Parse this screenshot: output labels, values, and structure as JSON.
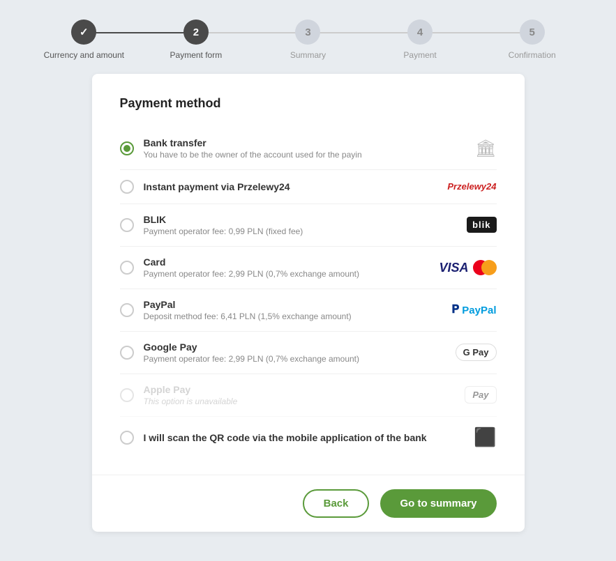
{
  "stepper": {
    "steps": [
      {
        "number": "✓",
        "label": "Currency and amount",
        "state": "completed"
      },
      {
        "number": "2",
        "label": "Payment form",
        "state": "active"
      },
      {
        "number": "3",
        "label": "Summary",
        "state": "inactive"
      },
      {
        "number": "4",
        "label": "Payment",
        "state": "inactive"
      },
      {
        "number": "5",
        "label": "Confirmation",
        "state": "inactive"
      }
    ]
  },
  "card": {
    "title": "Payment method",
    "options": [
      {
        "id": "bank-transfer",
        "selected": true,
        "disabled": false,
        "title": "Bank transfer",
        "subtitle": "You have to be the owner of the account used for the payin",
        "logo_type": "bank"
      },
      {
        "id": "przelewy24",
        "selected": false,
        "disabled": false,
        "title": "Instant payment via Przelewy24",
        "subtitle": "",
        "logo_type": "p24"
      },
      {
        "id": "blik",
        "selected": false,
        "disabled": false,
        "title": "BLIK",
        "subtitle": "Payment operator fee: 0,99 PLN (fixed fee)",
        "logo_type": "blik"
      },
      {
        "id": "card",
        "selected": false,
        "disabled": false,
        "title": "Card",
        "subtitle": "Payment operator fee: 2,99 PLN (0,7% exchange amount)",
        "logo_type": "card"
      },
      {
        "id": "paypal",
        "selected": false,
        "disabled": false,
        "title": "PayPal",
        "subtitle": "Deposit method fee: 6,41 PLN (1,5% exchange amount)",
        "logo_type": "paypal"
      },
      {
        "id": "google-pay",
        "selected": false,
        "disabled": false,
        "title": "Google Pay",
        "subtitle": "Payment operator fee: 2,99 PLN (0,7% exchange amount)",
        "logo_type": "gpay"
      },
      {
        "id": "apple-pay",
        "selected": false,
        "disabled": true,
        "title": "Apple Pay",
        "subtitle": "This option is unavailable",
        "logo_type": "apay"
      },
      {
        "id": "qr-code",
        "selected": false,
        "disabled": false,
        "title": "I will scan the QR code via the mobile application of the bank",
        "subtitle": "",
        "logo_type": "qr"
      }
    ],
    "footer": {
      "back_label": "Back",
      "next_label": "Go to summary"
    }
  }
}
